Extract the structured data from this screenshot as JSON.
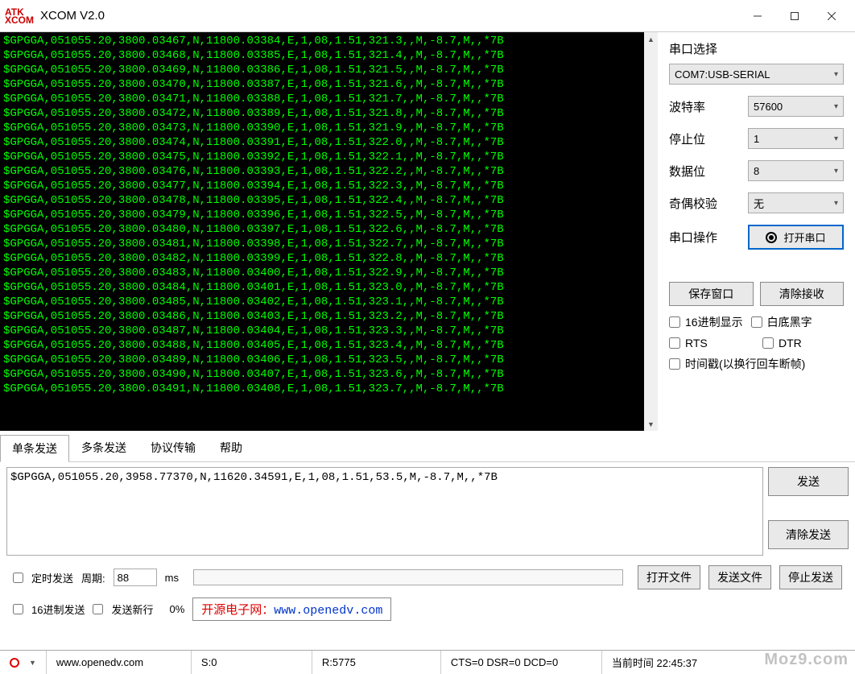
{
  "window": {
    "title": "XCOM V2.0",
    "logo_top": "ATK",
    "logo_bottom": "XCOM"
  },
  "terminal_lines": [
    "$GPGGA,051055.20,3800.03467,N,11800.03384,E,1,08,1.51,321.3,,M,-8.7,M,,*7B",
    "$GPGGA,051055.20,3800.03468,N,11800.03385,E,1,08,1.51,321.4,,M,-8.7,M,,*7B",
    "$GPGGA,051055.20,3800.03469,N,11800.03386,E,1,08,1.51,321.5,,M,-8.7,M,,*7B",
    "$GPGGA,051055.20,3800.03470,N,11800.03387,E,1,08,1.51,321.6,,M,-8.7,M,,*7B",
    "$GPGGA,051055.20,3800.03471,N,11800.03388,E,1,08,1.51,321.7,,M,-8.7,M,,*7B",
    "$GPGGA,051055.20,3800.03472,N,11800.03389,E,1,08,1.51,321.8,,M,-8.7,M,,*7B",
    "$GPGGA,051055.20,3800.03473,N,11800.03390,E,1,08,1.51,321.9,,M,-8.7,M,,*7B",
    "$GPGGA,051055.20,3800.03474,N,11800.03391,E,1,08,1.51,322.0,,M,-8.7,M,,*7B",
    "$GPGGA,051055.20,3800.03475,N,11800.03392,E,1,08,1.51,322.1,,M,-8.7,M,,*7B",
    "$GPGGA,051055.20,3800.03476,N,11800.03393,E,1,08,1.51,322.2,,M,-8.7,M,,*7B",
    "$GPGGA,051055.20,3800.03477,N,11800.03394,E,1,08,1.51,322.3,,M,-8.7,M,,*7B",
    "$GPGGA,051055.20,3800.03478,N,11800.03395,E,1,08,1.51,322.4,,M,-8.7,M,,*7B",
    "$GPGGA,051055.20,3800.03479,N,11800.03396,E,1,08,1.51,322.5,,M,-8.7,M,,*7B",
    "$GPGGA,051055.20,3800.03480,N,11800.03397,E,1,08,1.51,322.6,,M,-8.7,M,,*7B",
    "$GPGGA,051055.20,3800.03481,N,11800.03398,E,1,08,1.51,322.7,,M,-8.7,M,,*7B",
    "$GPGGA,051055.20,3800.03482,N,11800.03399,E,1,08,1.51,322.8,,M,-8.7,M,,*7B",
    "$GPGGA,051055.20,3800.03483,N,11800.03400,E,1,08,1.51,322.9,,M,-8.7,M,,*7B",
    "$GPGGA,051055.20,3800.03484,N,11800.03401,E,1,08,1.51,323.0,,M,-8.7,M,,*7B",
    "$GPGGA,051055.20,3800.03485,N,11800.03402,E,1,08,1.51,323.1,,M,-8.7,M,,*7B",
    "$GPGGA,051055.20,3800.03486,N,11800.03403,E,1,08,1.51,323.2,,M,-8.7,M,,*7B",
    "$GPGGA,051055.20,3800.03487,N,11800.03404,E,1,08,1.51,323.3,,M,-8.7,M,,*7B",
    "$GPGGA,051055.20,3800.03488,N,11800.03405,E,1,08,1.51,323.4,,M,-8.7,M,,*7B",
    "$GPGGA,051055.20,3800.03489,N,11800.03406,E,1,08,1.51,323.5,,M,-8.7,M,,*7B",
    "$GPGGA,051055.20,3800.03490,N,11800.03407,E,1,08,1.51,323.6,,M,-8.7,M,,*7B",
    "$GPGGA,051055.20,3800.03491,N,11800.03408,E,1,08,1.51,323.7,,M,-8.7,M,,*7B"
  ],
  "sidebar": {
    "port_select_label": "串口选择",
    "port_value": "COM7:USB-SERIAL",
    "baud": {
      "label": "波特率",
      "value": "57600"
    },
    "stop": {
      "label": "停止位",
      "value": "1"
    },
    "data": {
      "label": "数据位",
      "value": "8"
    },
    "parity": {
      "label": "奇偶校验",
      "value": "无"
    },
    "operation": {
      "label": "串口操作",
      "button": "打开串口"
    },
    "save_window": "保存窗口",
    "clear_receive": "清除接收",
    "hex_display": "16进制显示",
    "white_bg": "白底黑字",
    "rts": "RTS",
    "dtr": "DTR",
    "timestamp": "时间戳(以换行回车断帧)"
  },
  "tabs": [
    "单条发送",
    "多条发送",
    "协议传输",
    "帮助"
  ],
  "send": {
    "text": "$GPGGA,051055.20,3958.77370,N,11620.34591,E,1,08,1.51,53.5,M,-8.7,M,,*7B",
    "send_btn": "发送",
    "clear_btn": "清除发送"
  },
  "options": {
    "timed_send": "定时发送",
    "period_label": "周期:",
    "period_value": "88",
    "period_unit": "ms",
    "open_file": "打开文件",
    "send_file": "发送文件",
    "stop_send": "停止发送",
    "hex_send": "16进制发送",
    "send_newline": "发送新行",
    "progress_pct": "0%",
    "link_cn": "开源电子网：",
    "link_url": "www.openedv.com"
  },
  "status": {
    "url": "www.openedv.com",
    "s": "S:0",
    "r": "R:5775",
    "signals": "CTS=0 DSR=0 DCD=0",
    "time_label": "当前时间 22:45:37"
  },
  "watermark": "Moz9.com"
}
